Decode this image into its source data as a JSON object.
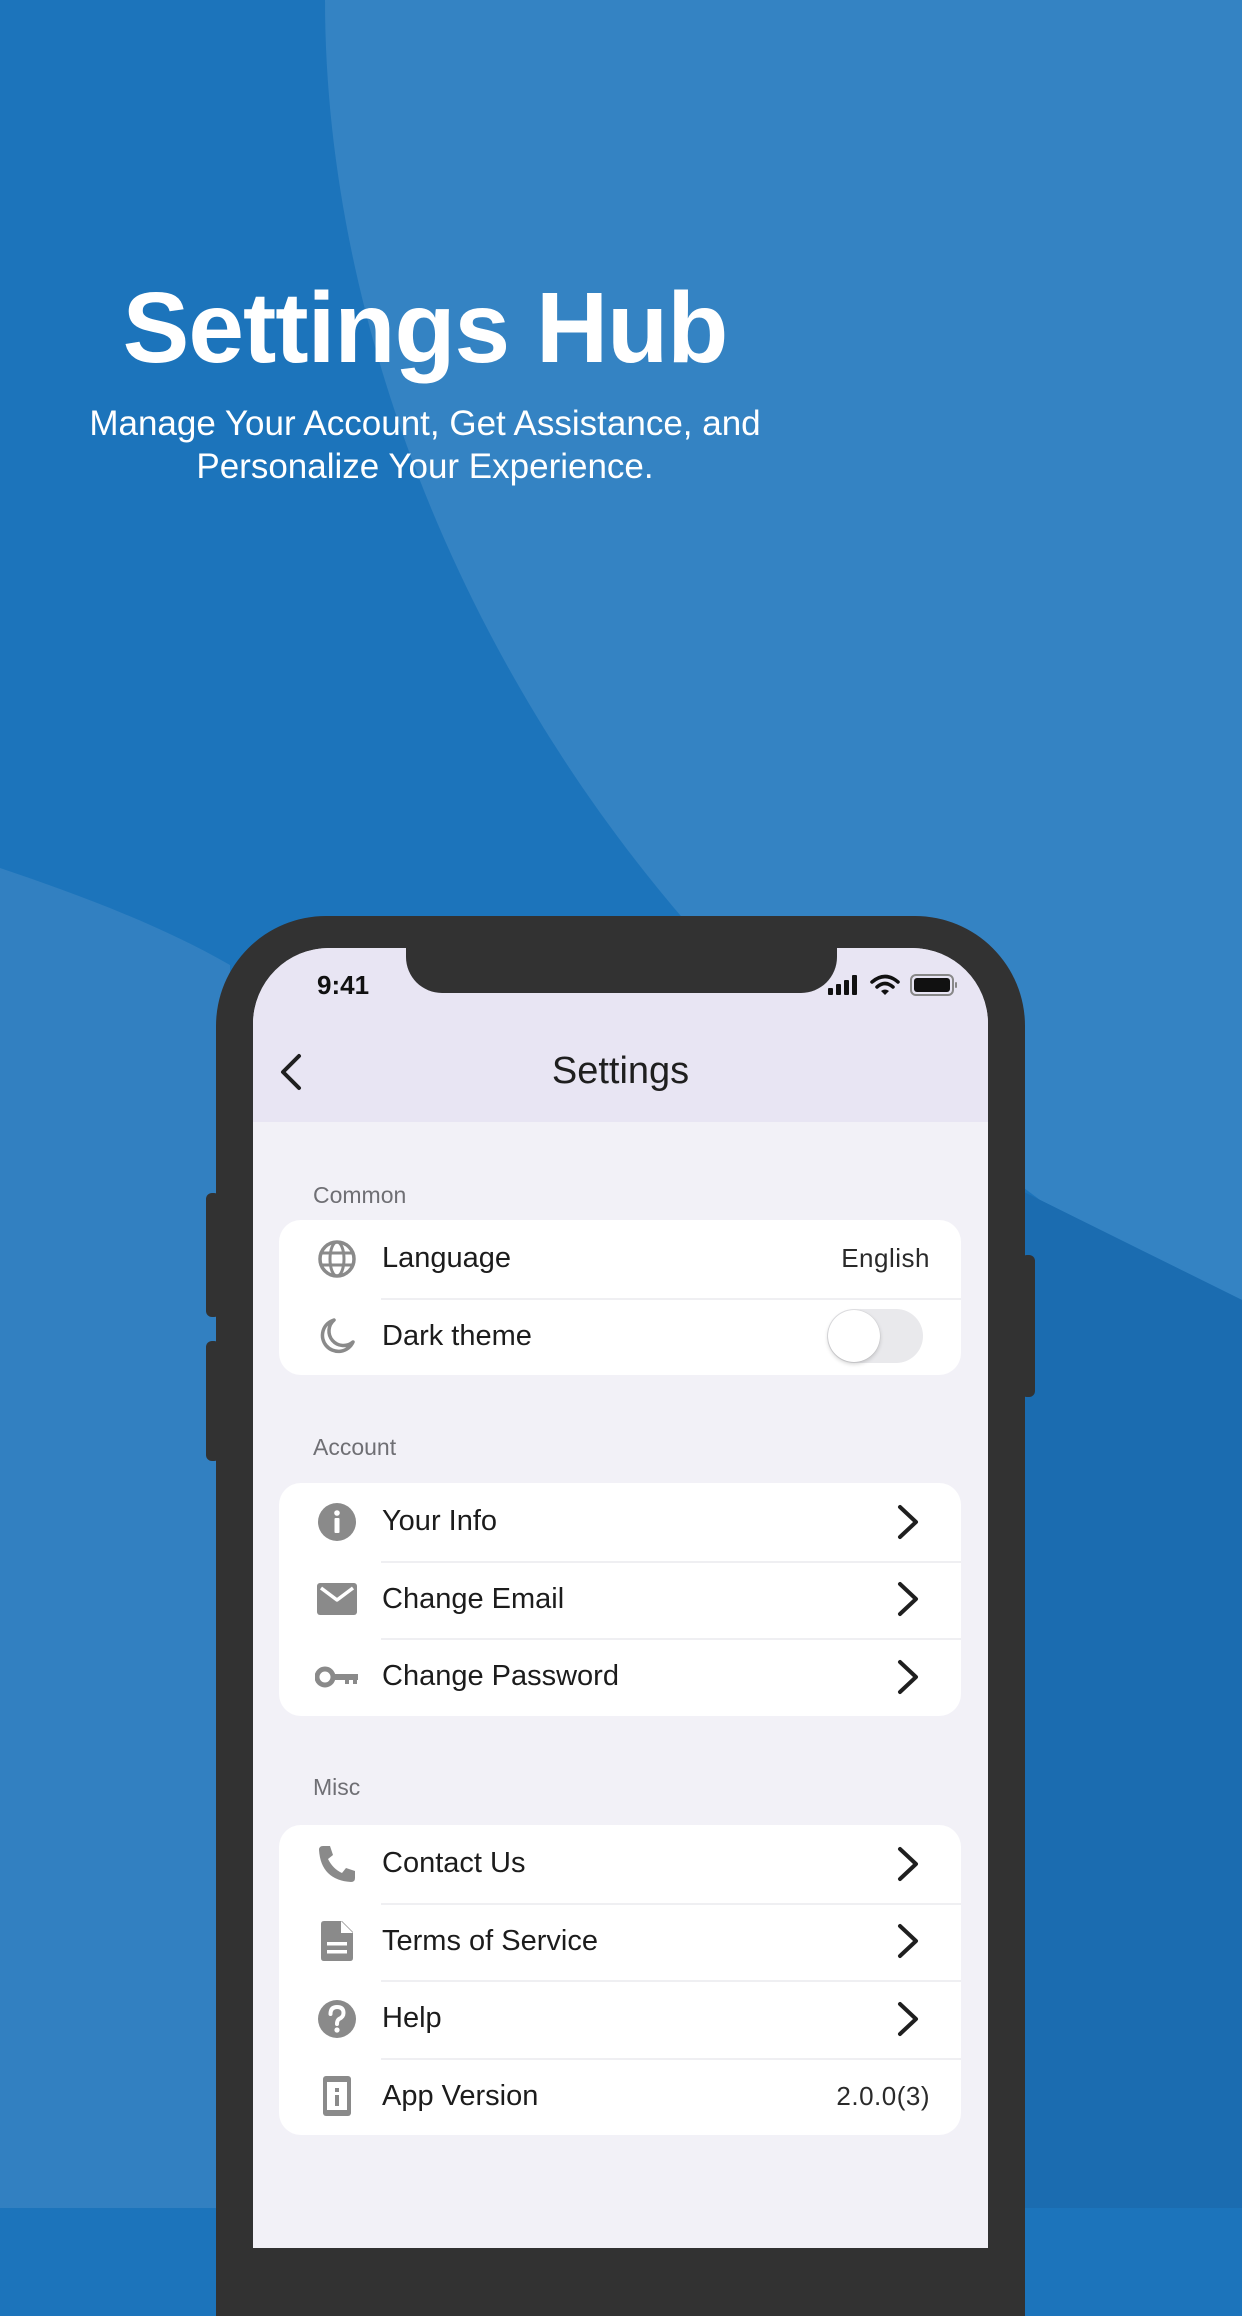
{
  "hero": {
    "title": "Settings Hub",
    "subtitle_line1": "Manage Your Account, Get Assistance, and",
    "subtitle_line2": "Personalize Your Experience."
  },
  "status_bar": {
    "time": "9:41",
    "icons": [
      "cellular-signal-icon",
      "wifi-icon",
      "battery-icon"
    ]
  },
  "nav": {
    "back_icon": "chevron-left-icon",
    "title": "Settings"
  },
  "sections": {
    "common": {
      "label": "Common",
      "items": [
        {
          "icon": "globe-icon",
          "label": "Language",
          "value": "English"
        },
        {
          "icon": "moon-icon",
          "label": "Dark theme",
          "toggle_on": false
        }
      ]
    },
    "account": {
      "label": "Account",
      "items": [
        {
          "icon": "info-icon",
          "label": "Your Info"
        },
        {
          "icon": "mail-icon",
          "label": "Change Email"
        },
        {
          "icon": "key-icon",
          "label": "Change Password"
        }
      ]
    },
    "misc": {
      "label": "Misc",
      "items": [
        {
          "icon": "phone-icon",
          "label": "Contact Us"
        },
        {
          "icon": "document-icon",
          "label": "Terms of Service"
        },
        {
          "icon": "help-icon",
          "label": "Help"
        },
        {
          "icon": "device-info-icon",
          "label": "App Version",
          "value": "2.0.0(3)"
        }
      ]
    }
  },
  "colors": {
    "background_dark": "#1c74bb",
    "background_light": "#3483c3",
    "background_bottom_right": "#1b6cb0",
    "phone_frame": "#323232",
    "navbar": "#e8e5f3",
    "screen_bg": "#f2f1f7",
    "icon_gray": "#8a8a8a"
  }
}
